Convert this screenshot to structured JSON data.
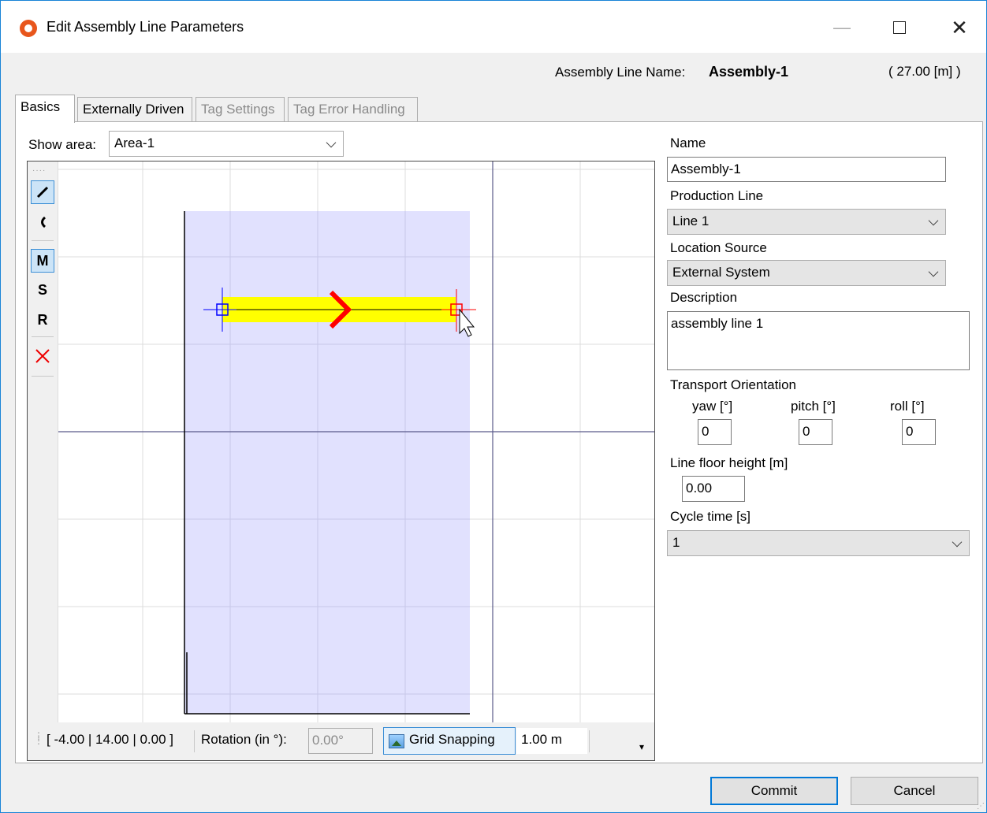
{
  "window": {
    "title": "Edit Assembly Line Parameters",
    "icon": "app-lifebuoy-icon",
    "controls": [
      "minimize-icon",
      "maximize-icon",
      "close-icon"
    ]
  },
  "header": {
    "name_label": "Assembly Line Name:",
    "name_value": "Assembly-1",
    "length": "( 27.00 [m] )"
  },
  "tabs": [
    {
      "label": "Basics",
      "state": "active"
    },
    {
      "label": "Externally Driven",
      "state": "enabled"
    },
    {
      "label": "Tag Settings",
      "state": "disabled"
    },
    {
      "label": "Tag Error Handling",
      "state": "disabled"
    }
  ],
  "show_area": {
    "label": "Show area:",
    "value": "Area-1"
  },
  "tools": {
    "grip": "····",
    "line_tool": "line-tool-icon",
    "arc_tool": "arc-tool-icon",
    "m": "M",
    "s": "S",
    "r": "R",
    "delete_tool": "delete-x-icon"
  },
  "canvas": {
    "area_fill": "#e1e1fe",
    "line_color": "#ffff00",
    "arrow_color": "#ff0000",
    "start_marker_color": "#0000ff",
    "end_marker_color": "#ff0000"
  },
  "statusbar": {
    "coords": "[ -4.00 | 14.00 | 0.00 ]",
    "rotation_label": "Rotation (in °):",
    "rotation_value": "0.00°",
    "grid_snapping": "Grid Snapping",
    "grid_value": "1.00 m"
  },
  "form": {
    "name_label": "Name",
    "name_value": "Assembly-1",
    "production_line_label": "Production Line",
    "production_line_value": "Line 1",
    "location_source_label": "Location Source",
    "location_source_value": "External System",
    "description_label": "Description",
    "description_value": "assembly line 1",
    "orientation_label": "Transport Orientation",
    "yaw_label": "yaw [°]",
    "yaw_value": "0",
    "pitch_label": "pitch [°]",
    "pitch_value": "0",
    "roll_label": "roll [°]",
    "roll_value": "0",
    "floor_height_label": "Line floor height [m]",
    "floor_height_value": "0.00",
    "cycle_time_label": "Cycle time [s]",
    "cycle_time_value": "1"
  },
  "buttons": {
    "commit": "Commit",
    "cancel": "Cancel"
  }
}
